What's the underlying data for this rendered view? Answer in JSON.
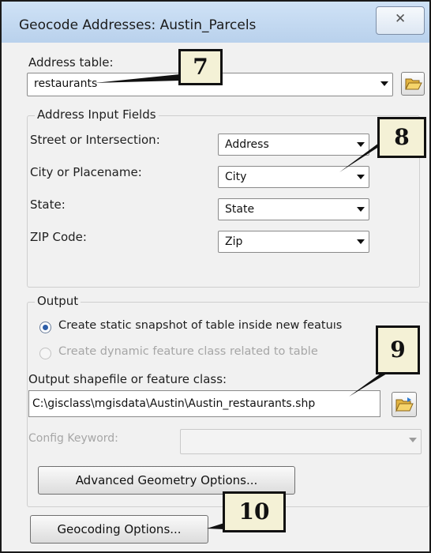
{
  "window": {
    "title": "Geocode Addresses:  Austin_Parcels",
    "close_glyph": "✕"
  },
  "address_table": {
    "label": "Address table:",
    "value": "restaurants",
    "browse_icon": "folder-open-icon"
  },
  "input_fields": {
    "title": "Address Input Fields",
    "rows": [
      {
        "label": "Street or Intersection:",
        "value": "Address"
      },
      {
        "label": "City or Placename:",
        "value": "City"
      },
      {
        "label": "State:",
        "value": "State"
      },
      {
        "label": "ZIP Code:",
        "value": "Zip"
      }
    ]
  },
  "output": {
    "title": "Output",
    "radio_static": "Create static snapshot of table inside new featuıs",
    "radio_dynamic": "Create dynamic feature class related to table",
    "shapefile_label": "Output shapefile or feature class:",
    "shapefile_value": "C:\\gisclass\\mgisdata\\Austin\\Austin_restaurants.shp",
    "config_label": "Config Keyword:",
    "config_value": "",
    "advanced_button": "Advanced Geometry Options..."
  },
  "geocoding_button": "Geocoding Options...",
  "callouts": [
    "7",
    "8",
    "9",
    "10"
  ],
  "colors": {
    "callout_fill": "#f4f1d6",
    "title_bar": "#c4d9f1",
    "radio_selected": "#2d5ea8"
  }
}
